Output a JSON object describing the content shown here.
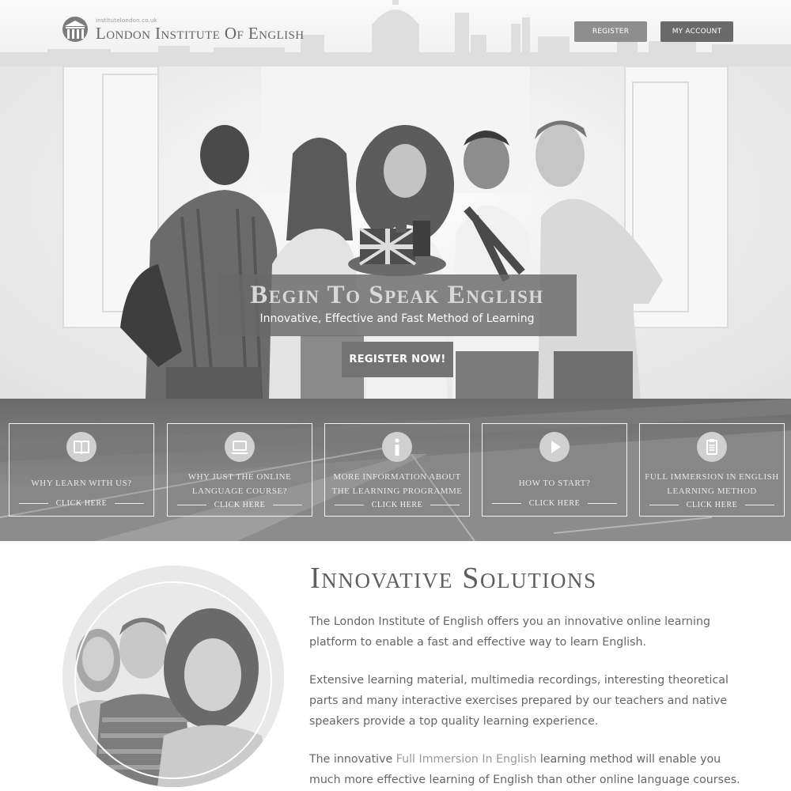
{
  "header": {
    "logo_domain": "institutelondon.co.uk",
    "logo_name": "London Institute Of English",
    "register_label": "REGISTER",
    "account_label": "MY ACCOUNT"
  },
  "hero": {
    "title": "Begin To Speak English",
    "subtitle": "Innovative, Effective and Fast Method of Learning",
    "cta_label": "REGISTER NOW!"
  },
  "features": [
    {
      "icon": "book-icon",
      "label": "Why learn with us?",
      "cta": "Click here"
    },
    {
      "icon": "laptop-icon",
      "label": "Why just the online language course?",
      "cta": "Click here"
    },
    {
      "icon": "info-icon",
      "label": "More information about the learning programme",
      "cta": "Click here"
    },
    {
      "icon": "play-icon",
      "label": "How to start?",
      "cta": "Click here"
    },
    {
      "icon": "clipboard-icon",
      "label": "Full immersion in English learning method",
      "cta": "Click here"
    }
  ],
  "content": {
    "title": "Innovative Solutions",
    "p1": "The London Institute of English offers you an innovative online learning platform to enable a fast and effective way to learn English.",
    "p2": "Extensive learning material, multimedia recordings, interesting theoretical parts and many interactive exercises prepared by our teachers and native speakers provide a top quality learning experience.",
    "p3_before": "The innovative ",
    "p3_link": "Full Immersion In English",
    "p3_after": " learning method will enable you much more effective learning of English than other online language courses."
  },
  "colors": {
    "header_button_register": "#8e8e8e",
    "header_button_account": "#6a6a6a",
    "caption_band": "#696969",
    "cta_button": "#737373",
    "link_highlight": "#9a9a9a"
  }
}
